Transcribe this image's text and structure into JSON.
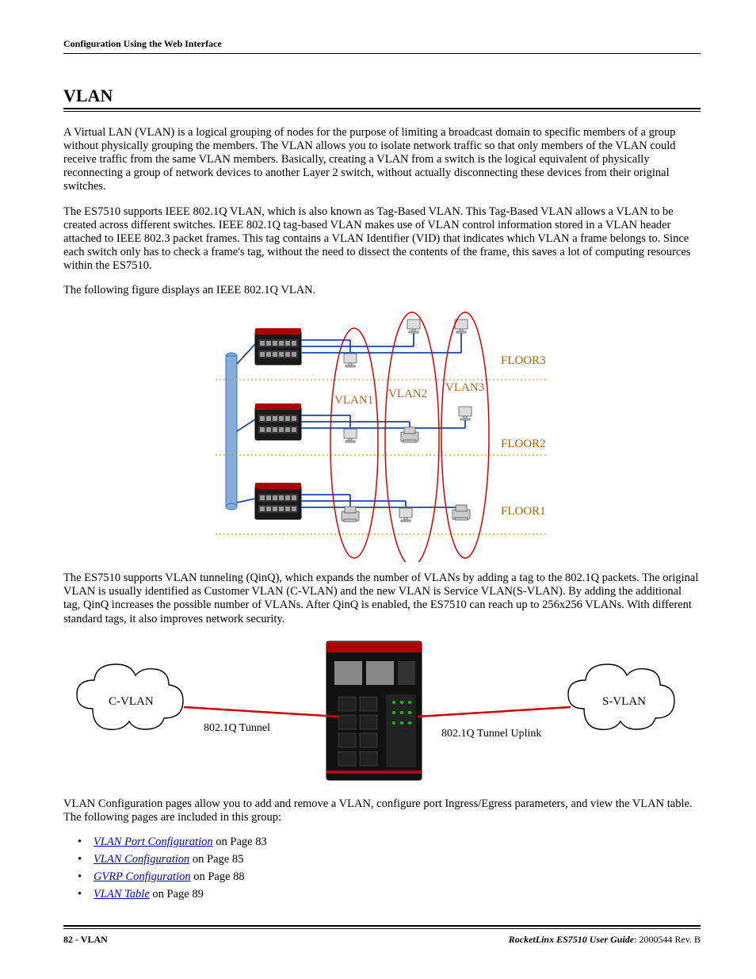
{
  "header": {
    "running": "Configuration Using the Web Interface"
  },
  "section": {
    "title": "VLAN",
    "p1": "A Virtual LAN (VLAN) is a logical grouping of nodes for the purpose of limiting a broadcast domain to specific members of a group without physically grouping the members. The VLAN allows you to isolate network traffic so that only members of the VLAN could receive traffic from the same VLAN members. Basically, creating a VLAN from a switch is the logical equivalent of physically reconnecting a group of network devices to another Layer 2 switch, without actually disconnecting these devices from their original switches.",
    "p2": "The ES7510 supports IEEE 802.1Q VLAN, which is also known as Tag-Based VLAN. This Tag-Based VLAN allows a VLAN to be created across different switches. IEEE 802.1Q tag-based VLAN makes use of VLAN control information stored in a VLAN header attached to IEEE 802.3 packet frames. This tag contains a VLAN Identifier (VID) that indicates which VLAN a frame belongs to. Since each switch only has to check a frame's tag, without the need to dissect the contents of the frame, this saves a lot of computing resources within the ES7510.",
    "p3": "The following figure displays an IEEE 802.1Q VLAN.",
    "p4": "The ES7510 supports VLAN tunneling (QinQ), which expands the number of VLANs by adding a tag to the 802.1Q packets. The original VLAN is usually identified as Customer VLAN (C-VLAN) and the new VLAN is Service VLAN(S-VLAN). By adding the additional tag, QinQ increases the possible number of VLANs. After QinQ is enabled, the ES7510 can reach up to 256x256 VLANs. With different standard tags, it also improves network security.",
    "p5": "VLAN Configuration pages allow you to add and remove a VLAN, configure port Ingress/Egress parameters, and view the VLAN table. The following pages are included in this group:"
  },
  "diag1": {
    "vlan1": "VLAN1",
    "vlan2": "VLAN2",
    "vlan3": "VLAN3",
    "floor1": "FLOOR1",
    "floor2": "FLOOR2",
    "floor3": "FLOOR3"
  },
  "diag2": {
    "cvlan": "C-VLAN",
    "svlan": "S-VLAN",
    "tunnel": "802.1Q Tunnel",
    "uplink": "802.1Q Tunnel Uplink"
  },
  "links": {
    "l1": {
      "text": "VLAN Port Configuration",
      "suffix": " on Page 83"
    },
    "l2": {
      "text": "VLAN Configuration",
      "suffix": " on Page 85"
    },
    "l3": {
      "text": "GVRP Configuration",
      "suffix": " on Page 88"
    },
    "l4": {
      "text": "VLAN Table",
      "suffix": " on Page 89"
    }
  },
  "footer": {
    "left": "82 - VLAN",
    "guide": "RocketLinx ES7510  User Guide",
    "rev": ": 2000544 Rev. B"
  }
}
